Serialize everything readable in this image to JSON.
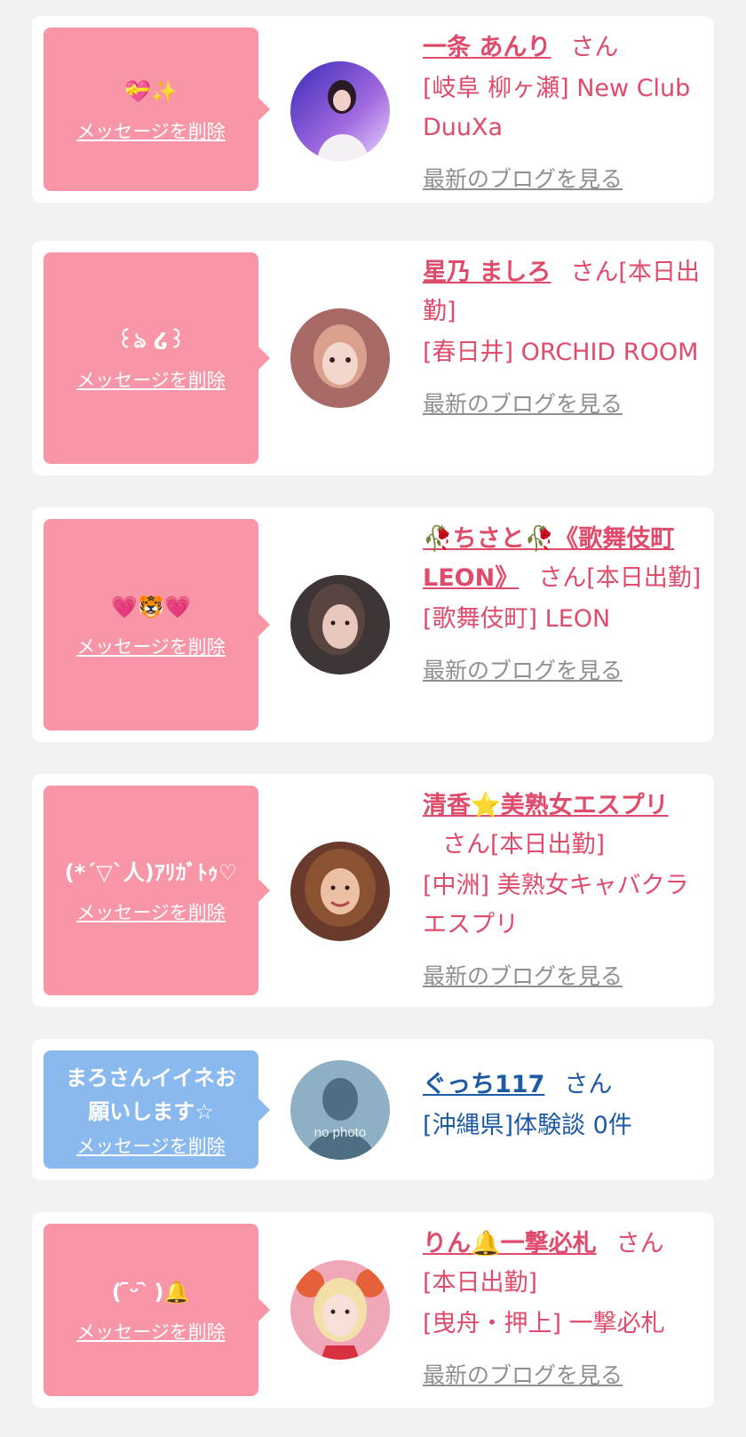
{
  "items": [
    {
      "message": "💝✨",
      "delete_label": "メッセージを削除",
      "name": "一条 あんり",
      "honorific": "さん",
      "tag": "",
      "store": "[岐阜 柳ヶ瀬] New Club DuuXa",
      "blog_link": "最新のブログを見る",
      "bubble_color": "#f895a6",
      "avatar": "photo-avatar-1"
    },
    {
      "message": "꒰ঌ ໒꒱",
      "delete_label": "メッセージを削除",
      "name": "星乃 ましろ",
      "honorific": "さん",
      "tag": "[本日出勤]",
      "store": "[春日井] ORCHID ROOM",
      "blog_link": "最新のブログを見る",
      "bubble_color": "#f895a6",
      "avatar": "photo-avatar-2"
    },
    {
      "message": "💗🐯💗",
      "delete_label": "メッセージを削除",
      "name": "🥀ちさと🥀《歌舞伎町LEON》",
      "honorific": "さん",
      "tag": "[本日出勤]",
      "store": "[歌舞伎町] LEON",
      "blog_link": "最新のブログを見る",
      "bubble_color": "#f895a6",
      "avatar": "photo-avatar-3"
    },
    {
      "message": "(*´▽`人)ｱﾘｶﾞﾄｩ♡",
      "delete_label": "メッセージを削除",
      "name": "清香⭐美熟女エスプリ",
      "honorific": "さん",
      "tag": "[本日出勤]",
      "store": "[中洲] 美熟女キャバクラ エスプリ",
      "blog_link": "最新のブログを見る",
      "bubble_color": "#f895a6",
      "avatar": "photo-avatar-4"
    },
    {
      "message": "まろさんイイネお\n願いします☆",
      "delete_label": "メッセージを削除",
      "name": "ぐっち117",
      "honorific": "さん",
      "tag": "",
      "store": "[沖縄県]体験談 0件",
      "blog_link": "",
      "bubble_color": "#8ab9ef",
      "avatar": "no-photo-avatar",
      "avatar_text": "no photo"
    },
    {
      "message": "( ᷇ᵕ ᷆ )🔔",
      "delete_label": "メッセージを削除",
      "name": "りん🔔一撃必札",
      "honorific": "さん",
      "tag": "[本日出勤]",
      "store": "[曳舟・押上] 一撃必札",
      "blog_link": "最新のブログを見る",
      "bubble_color": "#f895a6",
      "avatar": "photo-avatar-5"
    }
  ]
}
